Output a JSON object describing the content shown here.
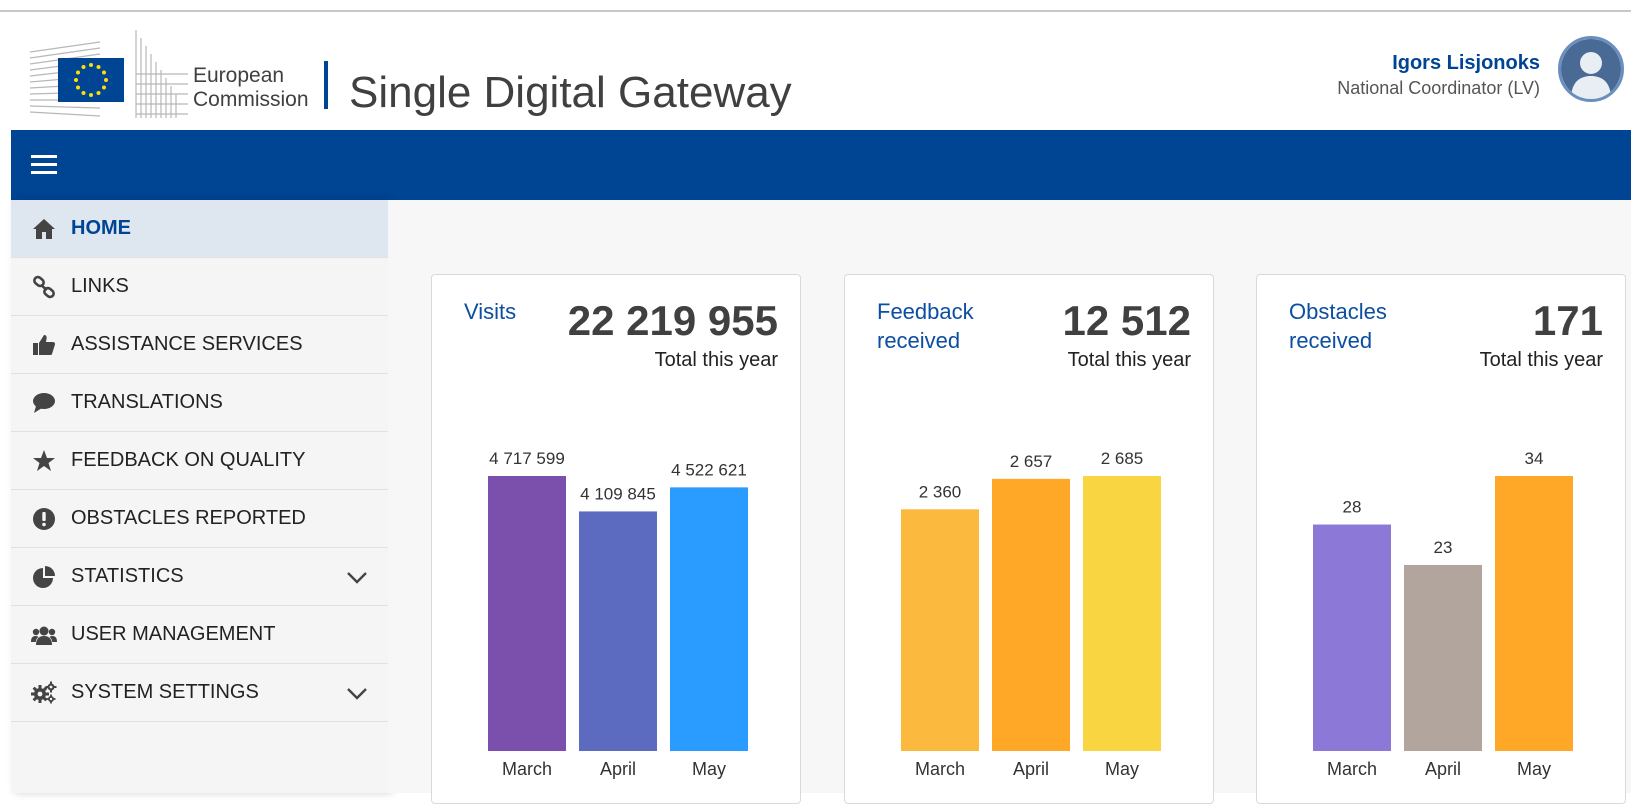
{
  "header": {
    "org_line1": "European",
    "org_line2": "Commission",
    "app_title": "Single Digital Gateway",
    "user_name": "Igors Lisjonoks",
    "user_role": "National Coordinator (LV)"
  },
  "navbar": {
    "menu_icon": "hamburger-icon",
    "color": "#004494"
  },
  "sidebar": {
    "items": [
      {
        "label": "HOME",
        "icon": "home-icon",
        "active": true,
        "expandable": false
      },
      {
        "label": "LINKS",
        "icon": "link-icon",
        "active": false,
        "expandable": false
      },
      {
        "label": "ASSISTANCE SERVICES",
        "icon": "thumbs-up-icon",
        "active": false,
        "expandable": false
      },
      {
        "label": "TRANSLATIONS",
        "icon": "speech-bubble-icon",
        "active": false,
        "expandable": false
      },
      {
        "label": "FEEDBACK ON QUALITY",
        "icon": "star-icon",
        "active": false,
        "expandable": false
      },
      {
        "label": "OBSTACLES REPORTED",
        "icon": "exclamation-circle-icon",
        "active": false,
        "expandable": false
      },
      {
        "label": "STATISTICS",
        "icon": "pie-chart-icon",
        "active": false,
        "expandable": true
      },
      {
        "label": "USER MANAGEMENT",
        "icon": "users-icon",
        "active": false,
        "expandable": false
      },
      {
        "label": "SYSTEM SETTINGS",
        "icon": "gears-icon",
        "active": false,
        "expandable": true
      }
    ]
  },
  "cards": [
    {
      "title": "Visits",
      "total": "22 219 955",
      "subtitle": "Total this year"
    },
    {
      "title": "Feedback received",
      "total": "12 512",
      "subtitle": "Total this year"
    },
    {
      "title": "Obstacles received",
      "total": "171",
      "subtitle": "Total this year"
    }
  ],
  "chart_data": [
    {
      "type": "bar",
      "categories": [
        "March",
        "April",
        "May"
      ],
      "values": [
        4717599,
        4109845,
        4522621
      ],
      "value_labels": [
        "4 717 599",
        "4 109 845",
        "4 522 621"
      ],
      "colors": [
        "#7b4fac",
        "#5c6bc0",
        "#2b9cff"
      ],
      "ylim": [
        0,
        4717599
      ]
    },
    {
      "type": "bar",
      "categories": [
        "March",
        "April",
        "May"
      ],
      "values": [
        2360,
        2657,
        2685
      ],
      "value_labels": [
        "2 360",
        "2 657",
        "2 685"
      ],
      "colors": [
        "#fbb93e",
        "#ffa726",
        "#fad542"
      ],
      "ylim": [
        0,
        2685
      ]
    },
    {
      "type": "bar",
      "categories": [
        "March",
        "April",
        "May"
      ],
      "values": [
        28,
        23,
        34
      ],
      "value_labels": [
        "28",
        "23",
        "34"
      ],
      "colors": [
        "#8c78d6",
        "#b2a59d",
        "#ffa726"
      ],
      "ylim": [
        0,
        34
      ]
    }
  ]
}
